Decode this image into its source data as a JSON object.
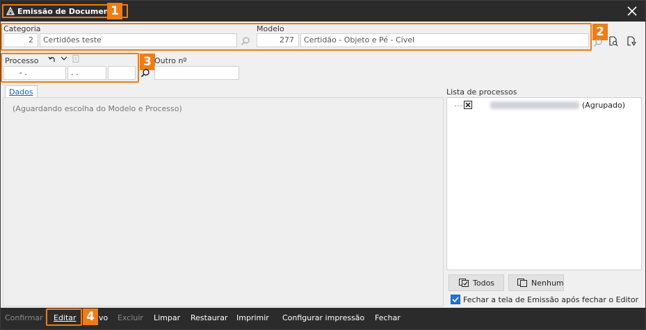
{
  "window": {
    "title": "Emissão de Documentos"
  },
  "badges": [
    "1",
    "2",
    "3",
    "4"
  ],
  "categoria": {
    "label": "Categoria",
    "code": "2",
    "name": "Certidões teste"
  },
  "modelo": {
    "label": "Modelo",
    "code": "277",
    "name": "Certidão - Objeto e Pé - Cível"
  },
  "processo": {
    "label": "Processo",
    "part1": "-  .",
    "part2": ".  .",
    "part3": ""
  },
  "outro": {
    "label": "Outro nº",
    "value": ""
  },
  "tabs": {
    "dados": "Dados"
  },
  "main": {
    "placeholder": "(Aguardando escolha do Modelo e Processo)"
  },
  "lista": {
    "label": "Lista de processos",
    "item_suffix": "(Agrupado)"
  },
  "buttons": {
    "todos": "Todos",
    "nenhum": "Nenhum"
  },
  "option": {
    "fechar_label": "Fechar a tela de Emissão após fechar o Editor",
    "checked": true
  },
  "footer": {
    "confirmar": "Confirmar",
    "editar": "Editar",
    "novo_tail": "vo",
    "excluir": "Excluir",
    "limpar": "Limpar",
    "restaurar": "Restaurar",
    "imprimir": "Imprimir",
    "configurar": "Configurar impressão",
    "fechar": "Fechar"
  },
  "colors": {
    "accent": "#f07c12",
    "titlebar": "#2b2b2b",
    "checkbox": "#1e74d8"
  }
}
